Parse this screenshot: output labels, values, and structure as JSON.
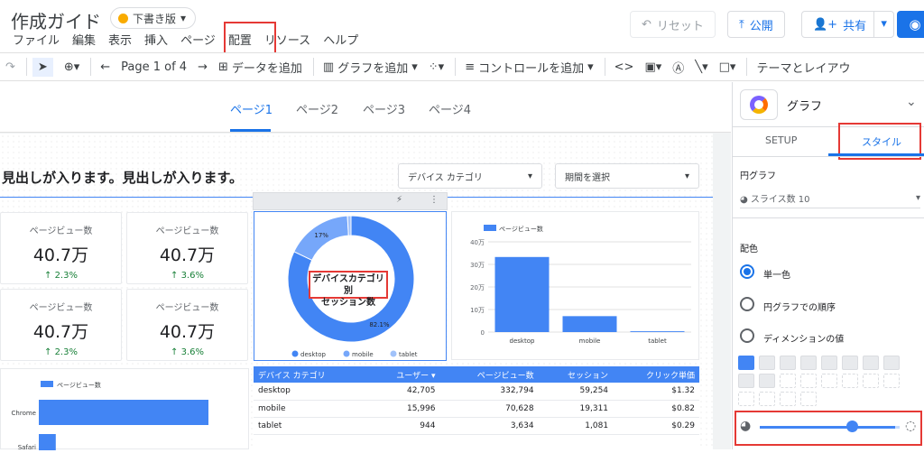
{
  "app": {
    "title": "作成ガイド",
    "draft_label": "下書き版"
  },
  "menu": [
    "ファイル",
    "編集",
    "表示",
    "挿入",
    "ページ",
    "配置",
    "リソース",
    "ヘルプ"
  ],
  "header": {
    "reset_label": "リセット",
    "publish_label": "公開",
    "share_label": "共有"
  },
  "toolbar": {
    "page_indicator": "Page 1 of 4",
    "add_data": "データを追加",
    "add_graph": "グラフを追加",
    "add_control": "コントロールを追加",
    "theme": "テーマとレイアウ"
  },
  "tabs": [
    "ページ1",
    "ページ2",
    "ページ3",
    "ページ4"
  ],
  "report": {
    "headline": "見出しが入ります。見出しが入ります。",
    "dropdown_device": "デバイス カテゴリ",
    "dropdown_period": "期間を選択",
    "scorecards": [
      {
        "label": "ページビュー数",
        "value": "40.7万",
        "delta": "↑ 2.3%"
      },
      {
        "label": "ページビュー数",
        "value": "40.7万",
        "delta": "↑ 3.6%"
      },
      {
        "label": "ページビュー数",
        "value": "40.7万",
        "delta": "↑ 2.3%"
      },
      {
        "label": "ページビュー数",
        "value": "40.7万",
        "delta": "↑ 3.6%"
      }
    ]
  },
  "chart_data": [
    {
      "type": "pie",
      "title": "デバイスカテゴリ別\nセッション数",
      "categories": [
        "desktop",
        "mobile",
        "tablet"
      ],
      "values": [
        82.1,
        17.0,
        0.9
      ],
      "labels": [
        "82.1%",
        "17%",
        ""
      ],
      "colors": [
        "#4285f4",
        "#76a7fa",
        "#a1c2fa"
      ]
    },
    {
      "type": "bar",
      "legend": "ページビュー数",
      "categories": [
        "desktop",
        "mobile",
        "tablet"
      ],
      "values": [
        332794,
        70628,
        3634
      ],
      "ylim": [
        0,
        400000
      ],
      "yticks": [
        "0",
        "10万",
        "20万",
        "30万",
        "40万"
      ]
    },
    {
      "type": "bar",
      "orientation": "horizontal",
      "legend": "ページビュー数",
      "categories": [
        "Chrome",
        "Safari"
      ],
      "values": [
        100,
        10
      ]
    },
    {
      "type": "table",
      "columns": [
        "デバイス カテゴリ",
        "ユーザー ▾",
        "ページビュー数",
        "セッション",
        "クリック単価"
      ],
      "rows": [
        [
          "desktop",
          "42,705",
          "332,794",
          "59,254",
          "$1.32"
        ],
        [
          "mobile",
          "15,996",
          "70,628",
          "19,311",
          "$0.82"
        ],
        [
          "tablet",
          "944",
          "3,634",
          "1,081",
          "$0.29"
        ]
      ]
    }
  ],
  "panel": {
    "title": "グラフ",
    "tab_setup": "SETUP",
    "tab_style": "スタイル",
    "pie_section": "円グラフ",
    "slice_count": "スライス数 10",
    "color_section": "配色",
    "radio_single": "単一色",
    "radio_order": "円グラフでの順序",
    "radio_dimension": "ディメンションの値",
    "selected_color": "#4285f4"
  }
}
